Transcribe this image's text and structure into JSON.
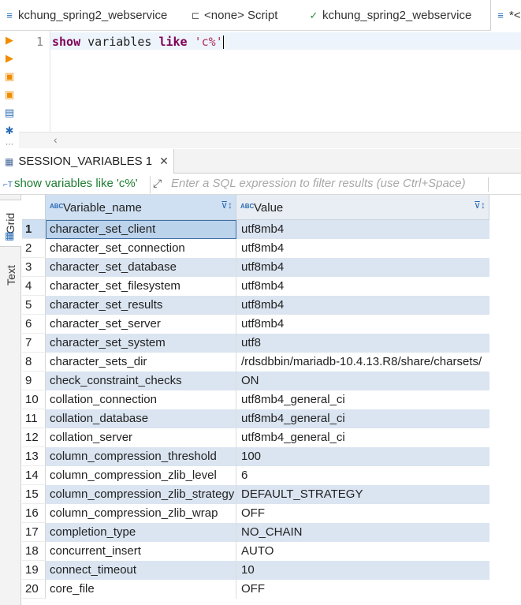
{
  "editor_tabs": [
    {
      "label": "kchung_spring2_webservice",
      "icon": "sql-editor-icon"
    },
    {
      "label": "<none> Script",
      "icon": "script-icon"
    },
    {
      "label": "kchung_spring2_webservice",
      "icon": "connection-icon"
    },
    {
      "label": "*<",
      "icon": "sql-editor-icon"
    }
  ],
  "editor": {
    "line_number": "1",
    "code": {
      "kw1": "show",
      "t1": " variables ",
      "kw2": "like",
      "t2": " ",
      "str": "'c%'"
    }
  },
  "result_tab": {
    "label": "SESSION_VARIABLES 1",
    "close": "✕"
  },
  "filter": {
    "query": "show variables like 'c%'",
    "placeholder": "Enter a SQL expression to filter results (use Ctrl+Space)"
  },
  "side_tabs": {
    "grid": "Grid",
    "text": "Text"
  },
  "columns": [
    {
      "name": "Variable_name",
      "type_badge": "ABC"
    },
    {
      "name": "Value",
      "type_badge": "ABC"
    }
  ],
  "rows": [
    {
      "n": "1",
      "name": "character_set_client",
      "value": "utf8mb4"
    },
    {
      "n": "2",
      "name": "character_set_connection",
      "value": "utf8mb4"
    },
    {
      "n": "3",
      "name": "character_set_database",
      "value": "utf8mb4"
    },
    {
      "n": "4",
      "name": "character_set_filesystem",
      "value": "utf8mb4"
    },
    {
      "n": "5",
      "name": "character_set_results",
      "value": "utf8mb4"
    },
    {
      "n": "6",
      "name": "character_set_server",
      "value": "utf8mb4"
    },
    {
      "n": "7",
      "name": "character_set_system",
      "value": "utf8"
    },
    {
      "n": "8",
      "name": "character_sets_dir",
      "value": "/rdsdbbin/mariadb-10.4.13.R8/share/charsets/"
    },
    {
      "n": "9",
      "name": "check_constraint_checks",
      "value": "ON"
    },
    {
      "n": "10",
      "name": "collation_connection",
      "value": "utf8mb4_general_ci"
    },
    {
      "n": "11",
      "name": "collation_database",
      "value": "utf8mb4_general_ci"
    },
    {
      "n": "12",
      "name": "collation_server",
      "value": "utf8mb4_general_ci"
    },
    {
      "n": "13",
      "name": "column_compression_threshold",
      "value": "100"
    },
    {
      "n": "14",
      "name": "column_compression_zlib_level",
      "value": "6"
    },
    {
      "n": "15",
      "name": "column_compression_zlib_strategy",
      "value": "DEFAULT_STRATEGY"
    },
    {
      "n": "16",
      "name": "column_compression_zlib_wrap",
      "value": "OFF"
    },
    {
      "n": "17",
      "name": "completion_type",
      "value": "NO_CHAIN"
    },
    {
      "n": "18",
      "name": "concurrent_insert",
      "value": "AUTO"
    },
    {
      "n": "19",
      "name": "connect_timeout",
      "value": "10"
    },
    {
      "n": "20",
      "name": "core_file",
      "value": "OFF"
    }
  ],
  "colors": {
    "accent": "#2a6cb5",
    "row_alt": "#dbe5f1",
    "keyword": "#7f0055",
    "string": "#b03060"
  }
}
